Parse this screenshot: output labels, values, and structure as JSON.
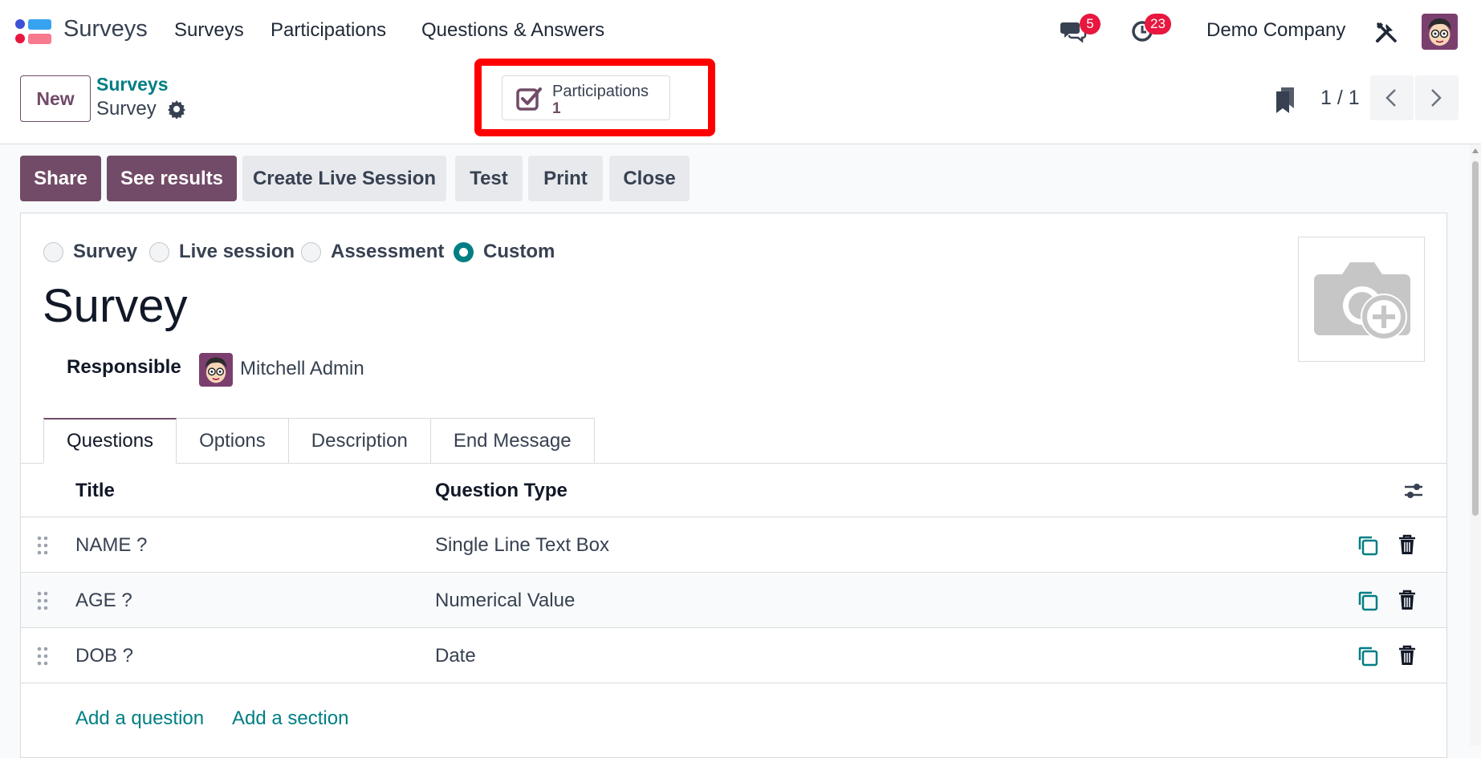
{
  "navbar": {
    "app_name": "Surveys",
    "menu": [
      "Surveys",
      "Participations",
      "Questions & Answers"
    ],
    "messages_count": "5",
    "activities_count": "23",
    "company": "Demo Company"
  },
  "control_panel": {
    "new_label": "New",
    "breadcrumb_parent": "Surveys",
    "breadcrumb_current": "Survey",
    "stat_button": {
      "label": "Participations",
      "value": "1"
    },
    "pager": "1 / 1"
  },
  "actions": {
    "share": "Share",
    "see_results": "See results",
    "create_live_session": "Create Live Session",
    "test": "Test",
    "print": "Print",
    "close": "Close"
  },
  "form": {
    "survey_types": [
      "Survey",
      "Live session",
      "Assessment",
      "Custom"
    ],
    "selected_type": "Custom",
    "title": "Survey",
    "responsible_label": "Responsible",
    "responsible_name": "Mitchell Admin"
  },
  "tabs": [
    "Questions",
    "Options",
    "Description",
    "End Message"
  ],
  "active_tab": "Questions",
  "table": {
    "headers": {
      "title": "Title",
      "question_type": "Question Type"
    },
    "rows": [
      {
        "title": "NAME ?",
        "type": "Single Line Text Box"
      },
      {
        "title": "AGE ?",
        "type": "Numerical Value"
      },
      {
        "title": "DOB ?",
        "type": "Date"
      }
    ],
    "add_question": "Add a question",
    "add_section": "Add a section"
  },
  "colors": {
    "brand": "#714b67",
    "teal": "#017e84",
    "badge": "#e8173f",
    "highlight": "#ff0000"
  }
}
